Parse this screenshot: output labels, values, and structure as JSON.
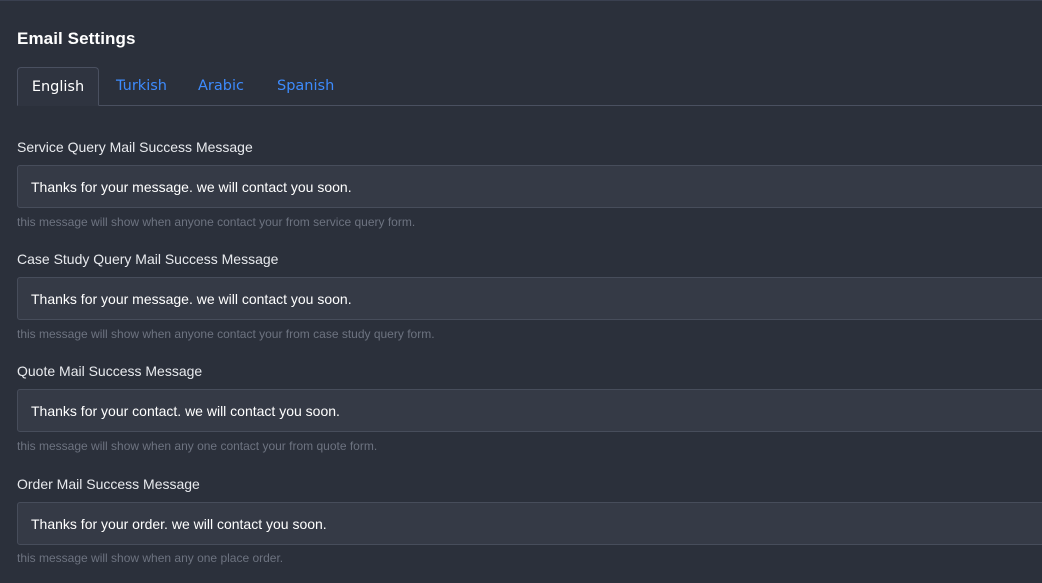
{
  "page": {
    "title": "Email Settings"
  },
  "tabs": [
    {
      "label": "English",
      "active": true
    },
    {
      "label": "Turkish",
      "active": false
    },
    {
      "label": "Arabic",
      "active": false
    },
    {
      "label": "Spanish",
      "active": false
    }
  ],
  "fields": {
    "service": {
      "label": "Service Query Mail Success Message",
      "value": "Thanks for your message. we will contact you soon.",
      "hint": "this message will show when anyone contact your from service query form."
    },
    "case_study": {
      "label": "Case Study Query Mail Success Message",
      "value": "Thanks for your message. we will contact you soon.",
      "hint": "this message will show when anyone contact your from case study query form."
    },
    "quote": {
      "label": "Quote Mail Success Message",
      "value": "Thanks for your contact. we will contact you soon.",
      "hint": "this message will show when any one contact your from quote form."
    },
    "order": {
      "label": "Order Mail Success Message",
      "value": "Thanks for your order. we will contact you soon.",
      "hint": "this message will show when any one place order."
    }
  },
  "colors": {
    "background": "#2b303b",
    "input_background": "#353a46",
    "tab_link": "#3d8bfd",
    "hint_text": "#6d7380"
  }
}
